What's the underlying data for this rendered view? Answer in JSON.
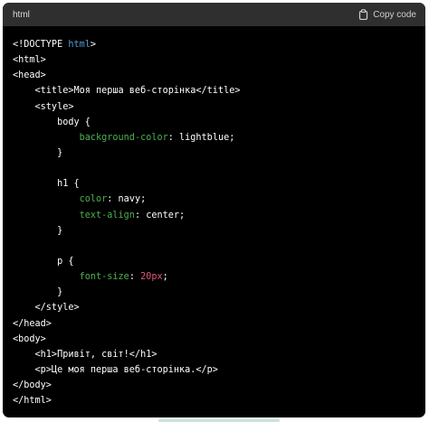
{
  "header": {
    "language": "html",
    "copy_label": "Copy code"
  },
  "code": {
    "lines": [
      {
        "parts": [
          {
            "t": "<!DOCTYPE "
          },
          {
            "t": "html",
            "c": "kw"
          },
          {
            "t": ">"
          }
        ]
      },
      {
        "parts": [
          {
            "t": "<html>"
          }
        ]
      },
      {
        "parts": [
          {
            "t": "<head>"
          }
        ]
      },
      {
        "parts": [
          {
            "t": "    <title>Моя перша веб-сторінка</title>"
          }
        ]
      },
      {
        "parts": [
          {
            "t": "    <style>"
          }
        ]
      },
      {
        "parts": [
          {
            "t": "        body {"
          }
        ]
      },
      {
        "parts": [
          {
            "t": "            "
          },
          {
            "t": "background-color",
            "c": "prop"
          },
          {
            "t": ": lightblue;"
          }
        ]
      },
      {
        "parts": [
          {
            "t": "        }"
          }
        ]
      },
      {
        "parts": [
          {
            "t": ""
          }
        ]
      },
      {
        "parts": [
          {
            "t": "        h1 {"
          }
        ]
      },
      {
        "parts": [
          {
            "t": "            "
          },
          {
            "t": "color",
            "c": "prop"
          },
          {
            "t": ": navy;"
          }
        ]
      },
      {
        "parts": [
          {
            "t": "            "
          },
          {
            "t": "text-align",
            "c": "prop"
          },
          {
            "t": ": center;"
          }
        ]
      },
      {
        "parts": [
          {
            "t": "        }"
          }
        ]
      },
      {
        "parts": [
          {
            "t": ""
          }
        ]
      },
      {
        "parts": [
          {
            "t": "        p {"
          }
        ]
      },
      {
        "parts": [
          {
            "t": "            "
          },
          {
            "t": "font-size",
            "c": "prop"
          },
          {
            "t": ": "
          },
          {
            "t": "20px",
            "c": "num"
          },
          {
            "t": ";"
          }
        ]
      },
      {
        "parts": [
          {
            "t": "        }"
          }
        ]
      },
      {
        "parts": [
          {
            "t": "    </style>"
          }
        ]
      },
      {
        "parts": [
          {
            "t": "</head>"
          }
        ]
      },
      {
        "parts": [
          {
            "t": "<body>"
          }
        ]
      },
      {
        "parts": [
          {
            "t": "    <h1>Привіт, світ!</h1>"
          }
        ]
      },
      {
        "parts": [
          {
            "t": "    <p>Це моя перша веб-сторінка.</p>"
          }
        ]
      },
      {
        "parts": [
          {
            "t": "</body>"
          }
        ]
      },
      {
        "parts": [
          {
            "t": "</html>"
          }
        ]
      }
    ]
  },
  "colors": {
    "keyword": "#569cd6",
    "property": "#4caf50",
    "number": "#e0567b",
    "text": "#ffffff",
    "background": "#000000",
    "header_background": "#2f2f2f"
  },
  "icons": {
    "copy": "clipboard-icon"
  }
}
